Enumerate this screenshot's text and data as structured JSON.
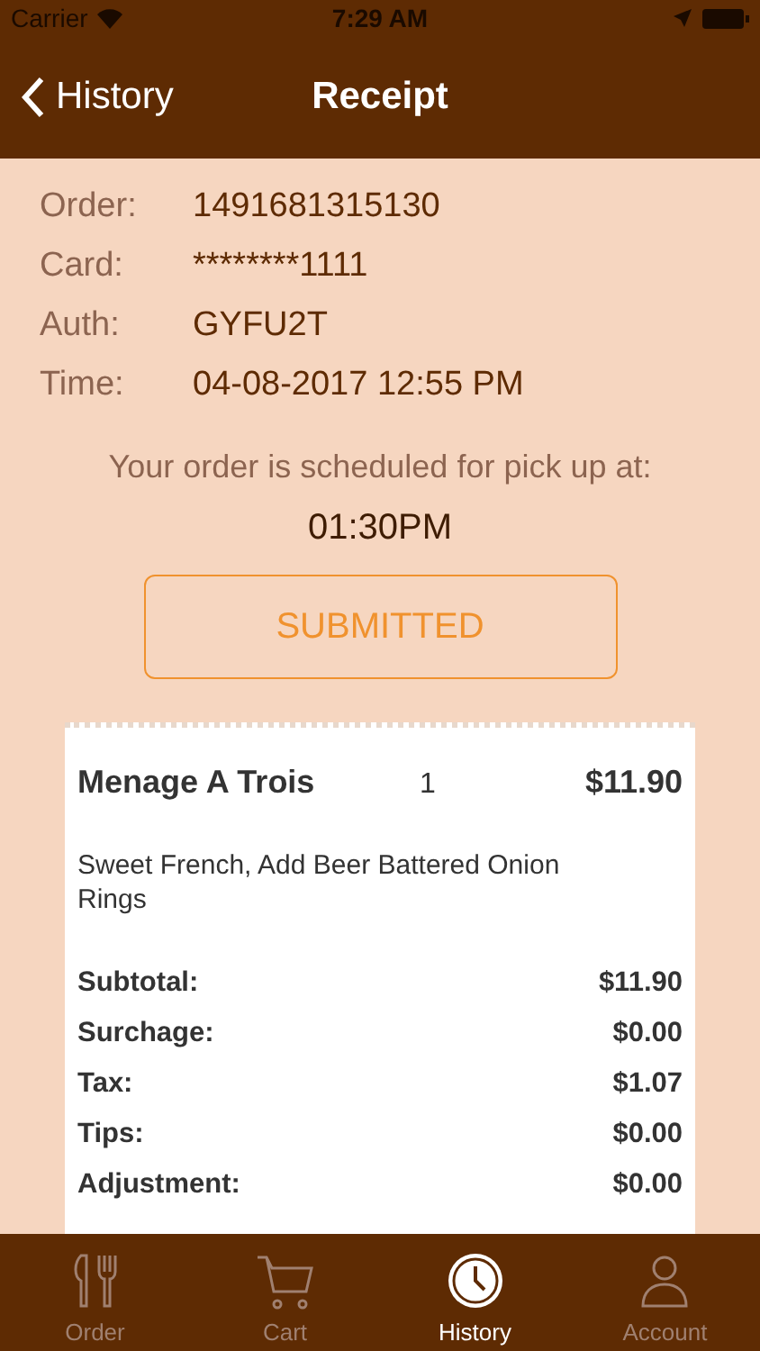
{
  "status_bar": {
    "carrier": "Carrier",
    "time": "7:29 AM"
  },
  "nav": {
    "back": "History",
    "title": "Receipt"
  },
  "details": [
    {
      "label": "Order:",
      "value": "1491681315130"
    },
    {
      "label": "Card:",
      "value": "********1111"
    },
    {
      "label": "Auth:",
      "value": "GYFU2T"
    },
    {
      "label": "Time:",
      "value": "04-08-2017 12:55 PM"
    }
  ],
  "pickup": {
    "message": "Your order is scheduled for pick up at:",
    "time": "01:30PM"
  },
  "status_button": "SUBMITTED",
  "receipt": {
    "items": [
      {
        "name": "Menage A Trois",
        "qty": "1",
        "price": "$11.90",
        "options": "Sweet French, Add Beer Battered Onion Rings"
      }
    ],
    "totals": [
      {
        "label": "Subtotal:",
        "value": "$11.90"
      },
      {
        "label": "Surchage:",
        "value": "$0.00"
      },
      {
        "label": "Tax:",
        "value": "$1.07"
      },
      {
        "label": "Tips:",
        "value": "$0.00"
      },
      {
        "label": "Adjustment:",
        "value": "$0.00"
      }
    ]
  },
  "tabs": [
    {
      "label": "Order",
      "kind": "utensils",
      "selected": false
    },
    {
      "label": "Cart",
      "kind": "cart",
      "selected": false
    },
    {
      "label": "History",
      "kind": "history",
      "selected": true
    },
    {
      "label": "Account",
      "kind": "person",
      "selected": false
    }
  ]
}
